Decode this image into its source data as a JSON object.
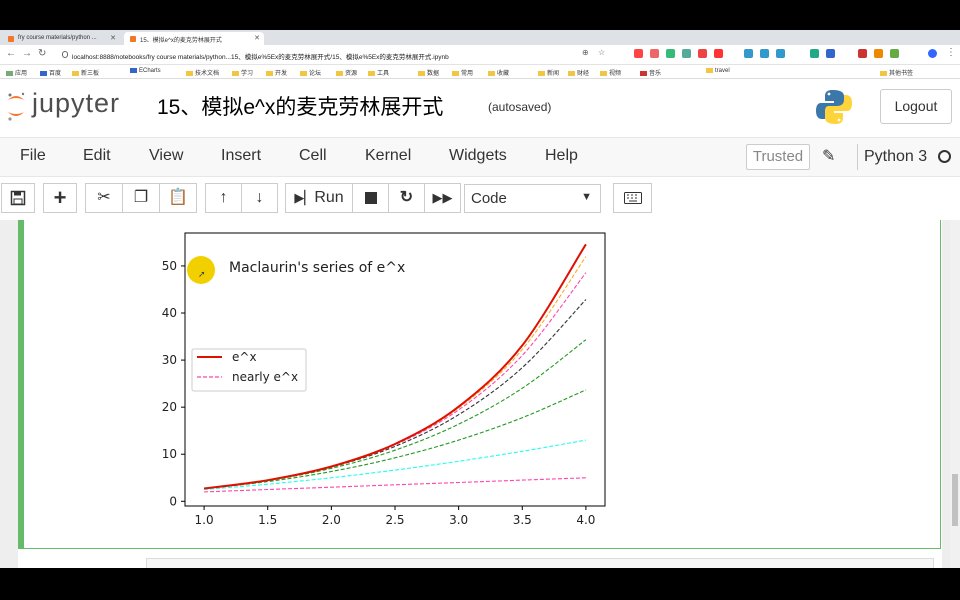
{
  "browser": {
    "tabs": [
      {
        "label": "fry course materials/python ..."
      },
      {
        "label": "15、模拟e^x的麦克劳林展开式"
      }
    ],
    "url": "localhost:8888/notebooks/fry course materials/python...15、模拟e%5Ex的麦克劳林展开式/15、模拟e%5Ex的麦克劳林展开式.ipynb",
    "bookmarks": [
      "应用",
      "百度",
      "新三板",
      "ECharts",
      "技术文档",
      "学习",
      "开发",
      "论坛",
      "资源",
      "工具",
      "数据",
      "常用",
      "收藏",
      "新闻",
      "财经",
      "视频",
      "音乐",
      "travel",
      "其他书签"
    ]
  },
  "header": {
    "logo_text": "jupyter",
    "notebook_title": "15、模拟e^x的麦克劳林展开式",
    "autosave_status": "(autosaved)",
    "logout_label": "Logout"
  },
  "menubar": {
    "items": [
      "File",
      "Edit",
      "View",
      "Insert",
      "Cell",
      "Kernel",
      "Widgets",
      "Help"
    ],
    "trusted_label": "Trusted",
    "kernel_name": "Python 3"
  },
  "toolbar": {
    "run_label": "Run",
    "cell_type": "Code"
  },
  "colors": {
    "cell_border": "#66bb6a",
    "exact_curve": "#dd1100",
    "approx_curve": "#ff44aa"
  },
  "chart_data": {
    "type": "line",
    "title": "Maclaurin's series of e^x",
    "xlim": [
      0.85,
      4.15
    ],
    "ylim": [
      -1,
      57
    ],
    "xticks": [
      "1.0",
      "1.5",
      "2.0",
      "2.5",
      "3.0",
      "3.5",
      "4.0"
    ],
    "yticks": [
      "0",
      "10",
      "20",
      "30",
      "40",
      "50"
    ],
    "grid": false,
    "legend": {
      "placement": "center-left",
      "entries": [
        "e^x",
        "nearly e^x"
      ]
    },
    "series": [
      {
        "name": "e^x",
        "color": "#dd1100",
        "style": "solid",
        "x": [
          1.0,
          1.5,
          2.0,
          2.5,
          3.0,
          3.5,
          4.0
        ],
        "y": [
          2.72,
          4.48,
          7.39,
          12.18,
          20.09,
          33.12,
          54.6
        ]
      },
      {
        "color": "#ff44aa",
        "style": "dashed",
        "x": [
          1.0,
          1.5,
          2.0,
          2.5,
          3.0,
          3.5,
          4.0
        ],
        "y": [
          2.0,
          2.5,
          3.0,
          3.5,
          4.0,
          4.5,
          5.0
        ]
      },
      {
        "color": "#22ffee",
        "style": "dashed",
        "x": [
          1.0,
          1.5,
          2.0,
          2.5,
          3.0,
          3.5,
          4.0
        ],
        "y": [
          2.5,
          3.63,
          5.0,
          6.63,
          8.5,
          10.63,
          13.0
        ]
      },
      {
        "color": "#229922",
        "style": "dashed",
        "x": [
          1.0,
          1.5,
          2.0,
          2.5,
          3.0,
          3.5,
          4.0
        ],
        "y": [
          2.67,
          4.19,
          6.33,
          9.23,
          13.0,
          17.77,
          23.67
        ]
      },
      {
        "color": "#229922",
        "style": "dashed",
        "x": [
          1.0,
          1.5,
          2.0,
          2.5,
          3.0,
          3.5,
          4.0
        ],
        "y": [
          2.71,
          4.4,
          7.0,
          10.85,
          16.38,
          24.02,
          34.33
        ]
      },
      {
        "color": "#333333",
        "style": "dashed",
        "x": [
          1.0,
          1.5,
          2.0,
          2.5,
          3.0,
          3.5,
          4.0
        ],
        "y": [
          2.72,
          4.46,
          7.27,
          11.66,
          18.4,
          28.4,
          42.87
        ]
      },
      {
        "color": "#ff44aa",
        "style": "dashed",
        "x": [
          1.0,
          1.5,
          2.0,
          2.5,
          3.0,
          3.5,
          4.0
        ],
        "y": [
          2.72,
          4.48,
          7.36,
          12.0,
          19.41,
          31.0,
          48.56
        ]
      },
      {
        "color": "#ffaa22",
        "style": "dashed",
        "x": [
          1.0,
          1.5,
          2.0,
          2.5,
          3.0,
          3.5,
          4.0
        ],
        "y": [
          2.72,
          4.48,
          7.38,
          12.13,
          19.84,
          32.26,
          52.0
        ]
      }
    ]
  }
}
